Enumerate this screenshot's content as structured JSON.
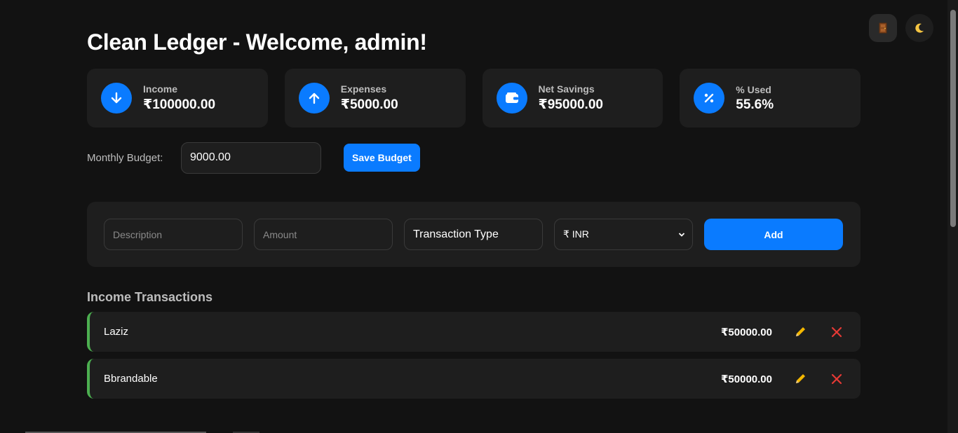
{
  "header": {
    "title": "Clean Ledger - Welcome, admin!"
  },
  "top_actions": {
    "logout_icon": "door-icon",
    "theme_icon": "moon-icon"
  },
  "stats": [
    {
      "label": "Income",
      "value": "₹100000.00",
      "icon": "arrow-down-icon"
    },
    {
      "label": "Expenses",
      "value": "₹5000.00",
      "icon": "arrow-up-icon"
    },
    {
      "label": "Net Savings",
      "value": "₹95000.00",
      "icon": "wallet-icon"
    },
    {
      "label": "% Used",
      "value": "55.6%",
      "icon": "percent-icon"
    }
  ],
  "budget": {
    "label": "Monthly Budget:",
    "value": "9000.00",
    "save_label": "Save Budget"
  },
  "form": {
    "description_placeholder": "Description",
    "amount_placeholder": "Amount",
    "type_value": "Transaction Type",
    "currency_value": "₹ INR",
    "add_label": "Add"
  },
  "income_section": {
    "title": "Income Transactions",
    "transactions": [
      {
        "description": "Laziz",
        "amount": "₹50000.00"
      },
      {
        "description": "Bbrandable",
        "amount": "₹50000.00"
      }
    ]
  },
  "colors": {
    "accent": "#0a7bff",
    "income_border": "#4caf50",
    "edit_icon": "#f5b800",
    "delete_icon": "#e53935"
  }
}
